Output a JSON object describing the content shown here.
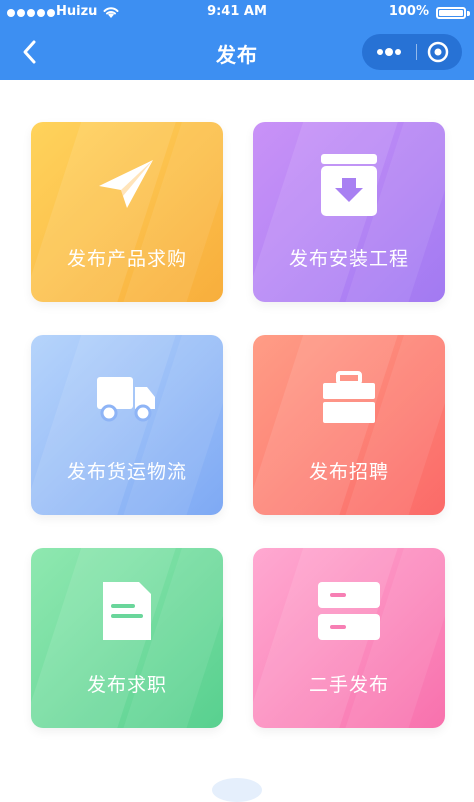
{
  "status_bar": {
    "carrier": "Huizu",
    "time": "9:41 AM",
    "battery": "100%",
    "battery_level": 1.0,
    "signal_dots": 5
  },
  "nav_bar": {
    "title": "发布",
    "back_icon": "chevron-left-icon",
    "more_icon": "more-dots-icon",
    "close_icon": "target-close-icon"
  },
  "colors": {
    "header": "#3d8ff2",
    "tile_1": [
      "#ffd35c",
      "#f8ae3c"
    ],
    "tile_2": [
      "#c992f7",
      "#a27af2"
    ],
    "tile_3": [
      "#b6d4fb",
      "#7ea9f4"
    ],
    "tile_4": [
      "#ff9d86",
      "#fb6a68"
    ],
    "tile_5": [
      "#8fe8b0",
      "#58d08f"
    ],
    "tile_6": [
      "#ffa9d1",
      "#f871ad"
    ]
  },
  "tiles": [
    {
      "label": "发布产品求购",
      "icon": "paper-plane-icon"
    },
    {
      "label": "发布安装工程",
      "icon": "download-box-icon"
    },
    {
      "label": "发布货运物流",
      "icon": "truck-icon"
    },
    {
      "label": "发布招聘",
      "icon": "briefcase-icon"
    },
    {
      "label": "发布求职",
      "icon": "document-icon"
    },
    {
      "label": "二手发布",
      "icon": "cabinet-icon"
    }
  ]
}
